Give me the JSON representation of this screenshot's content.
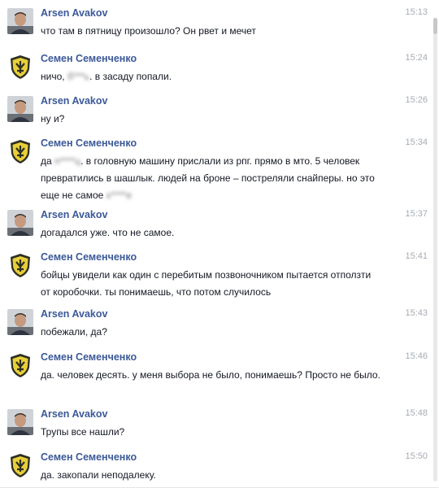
{
  "conversation": {
    "messages": [
      {
        "sender": "Arsen Avakov",
        "avatar": "person-avatar",
        "time": "15:13",
        "text": "что там в пятницу произошло? Он рвет и мечет"
      },
      {
        "sender": "Семен Семенченко",
        "avatar": "shield-emblem-avatar",
        "time": "15:24",
        "text_parts": [
          "ничо, ",
          "б***ь",
          ". в засаду попали."
        ]
      },
      {
        "sender": "Arsen Avakov",
        "avatar": "person-avatar",
        "time": "15:26",
        "text": "ну и?"
      },
      {
        "sender": "Семен Семенченко",
        "avatar": "shield-emblem-avatar",
        "time": "15:34",
        "text_parts": [
          "да ",
          "п****ц",
          ". в головную машину прислали из рпг. прямо в мто. 5 человек превратились в шашлык. людей на броне – постреляли снайперы. но это еще не самое ",
          "х****е"
        ]
      },
      {
        "sender": "Arsen Avakov",
        "avatar": "person-avatar",
        "time": "15:37",
        "text": "догадался уже. что не самое."
      },
      {
        "sender": "Семен Семенченко",
        "avatar": "shield-emblem-avatar",
        "time": "15:41",
        "text": "бойцы увидели как один с перебитым позвоночником пытается отползти от коробочки. ты понимаешь, что потом случилось"
      },
      {
        "sender": "Arsen Avakov",
        "avatar": "person-avatar",
        "time": "15:43",
        "text": "побежали, да?"
      },
      {
        "sender": "Семен Семенченко",
        "avatar": "shield-emblem-avatar",
        "time": "15:46",
        "text": "да. человек десять. у меня выбора не было, понимаешь? Просто не было."
      },
      {
        "sender": "Arsen Avakov",
        "avatar": "person-avatar",
        "time": "15:48",
        "text": "Трупы все нашли?"
      },
      {
        "sender": "Семен Семенченко",
        "avatar": "shield-emblem-avatar",
        "time": "15:50",
        "text": "да. закопали неподалеку."
      }
    ]
  },
  "colors": {
    "sender_name": "#3b5998",
    "timestamp": "#a6acb3",
    "message_text": "#141823"
  }
}
